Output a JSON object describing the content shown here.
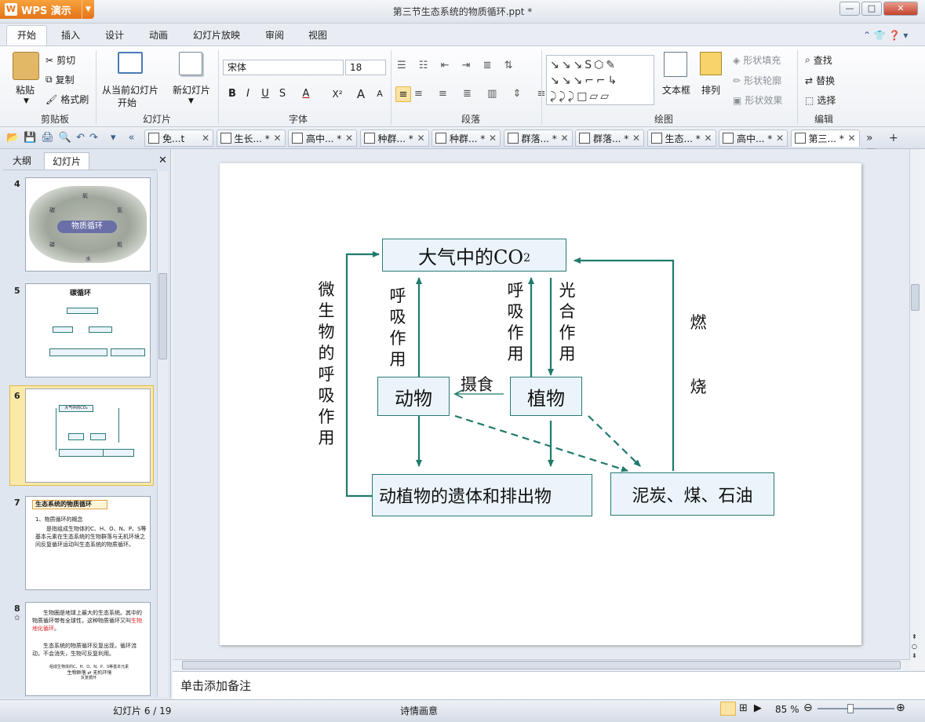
{
  "app": {
    "name": "WPS 演示",
    "doc_title": "第三节生态系统的物质循环.ppt *"
  },
  "window_controls": {
    "minimize": "—",
    "maximize": "□",
    "close": "✕"
  },
  "menu_tabs": [
    "开始",
    "插入",
    "设计",
    "动画",
    "幻灯片放映",
    "审阅",
    "视图"
  ],
  "ribbon": {
    "clipboard": {
      "paste": "粘贴",
      "cut": "剪切",
      "copy": "复制",
      "format_painter": "格式刷",
      "label": "剪贴板"
    },
    "slides": {
      "from_current": "从当前幻灯片",
      "from_current_2": "开始",
      "new_slide": "新幻灯片",
      "label": "幻灯片"
    },
    "font": {
      "name": "宋体",
      "size": "18",
      "label": "字体",
      "bold": "B",
      "italic": "I",
      "underline": "U",
      "shadow": "S",
      "color": "A",
      "superscript": "X²",
      "grow": "A",
      "shrink": "A"
    },
    "paragraph": {
      "label": "段落"
    },
    "drawing": {
      "textbox": "文本框",
      "arrange": "排列",
      "shape_fill": "形状填充",
      "shape_outline": "形状轮廓",
      "shape_effect": "形状效果",
      "label": "绘图"
    },
    "editing": {
      "find": "查找",
      "replace": "替换",
      "select": "选择",
      "label": "编辑"
    }
  },
  "doc_tabs": [
    {
      "label": "免...t",
      "active": false
    },
    {
      "label": "生长... *",
      "active": false
    },
    {
      "label": "高中... *",
      "active": false
    },
    {
      "label": "种群... *",
      "active": false
    },
    {
      "label": "种群... *",
      "active": false
    },
    {
      "label": "群落... *",
      "active": false
    },
    {
      "label": "群落... *",
      "active": false
    },
    {
      "label": "生态... *",
      "active": false
    },
    {
      "label": "高中... *",
      "active": false
    },
    {
      "label": "第三... *",
      "active": true
    }
  ],
  "left_pane": {
    "tab_outline": "大纲",
    "tab_slides": "幻灯片",
    "close": "✕",
    "thumbnails": [
      {
        "num": "4",
        "text": "物质循环",
        "labels": [
          "氧",
          "碳",
          "磷",
          "氢",
          "氮",
          "水"
        ]
      },
      {
        "num": "5",
        "text": "碳循环"
      },
      {
        "num": "6",
        "text": "大气中的CO₂",
        "selected": true
      },
      {
        "num": "7",
        "title": "生态系统的物质循环",
        "line1": "1、物质循环的概念",
        "body": "是指组成生物体的C、H、O、N、P、S等基本元素在生态系统的生物群落与无机环境之间反复循环运动叫生态系统的物质循环。"
      },
      {
        "num": "8",
        "line1": "生物圈是地球上最大的生态系统。其中的物质循环带有全球性，这种物质循环又叫",
        "highlight": "生物地化循环",
        "line1_end": "。",
        "line2": "生态系统的物质循环反复出现，循环流动，不会消失，生物可反复利用。",
        "footer": "生物群落 ⇄ 无机环境",
        "footer_top": "组成生物体的C、H、O、N、P、S等基本元素",
        "footer_bottom": "反复循环"
      }
    ]
  },
  "slide": {
    "top_box": "大气中的CO",
    "top_box_sub": "2",
    "animal": "动物",
    "plant": "植物",
    "remains": "动植物的遗体和排出物",
    "fossil": "泥炭、煤、石油",
    "eat": "摄食",
    "micro_resp": [
      "微",
      "生",
      "物",
      "的",
      "呼",
      "吸",
      "作",
      "用"
    ],
    "animal_resp": [
      "呼",
      "吸",
      "作",
      "用"
    ],
    "plant_resp": [
      "呼",
      "吸",
      "作",
      "用"
    ],
    "photo": [
      "光",
      "合",
      "作",
      "用"
    ],
    "burn_1": "燃",
    "burn_2": "烧",
    "colors": {
      "arrow": "#1f7a6c",
      "box_fill": "#eaf4fa"
    }
  },
  "notes_placeholder": "单击添加备注",
  "status": {
    "slide_info": "幻灯片 6 / 19",
    "theme": "诗情画意",
    "zoom": "85 %"
  }
}
